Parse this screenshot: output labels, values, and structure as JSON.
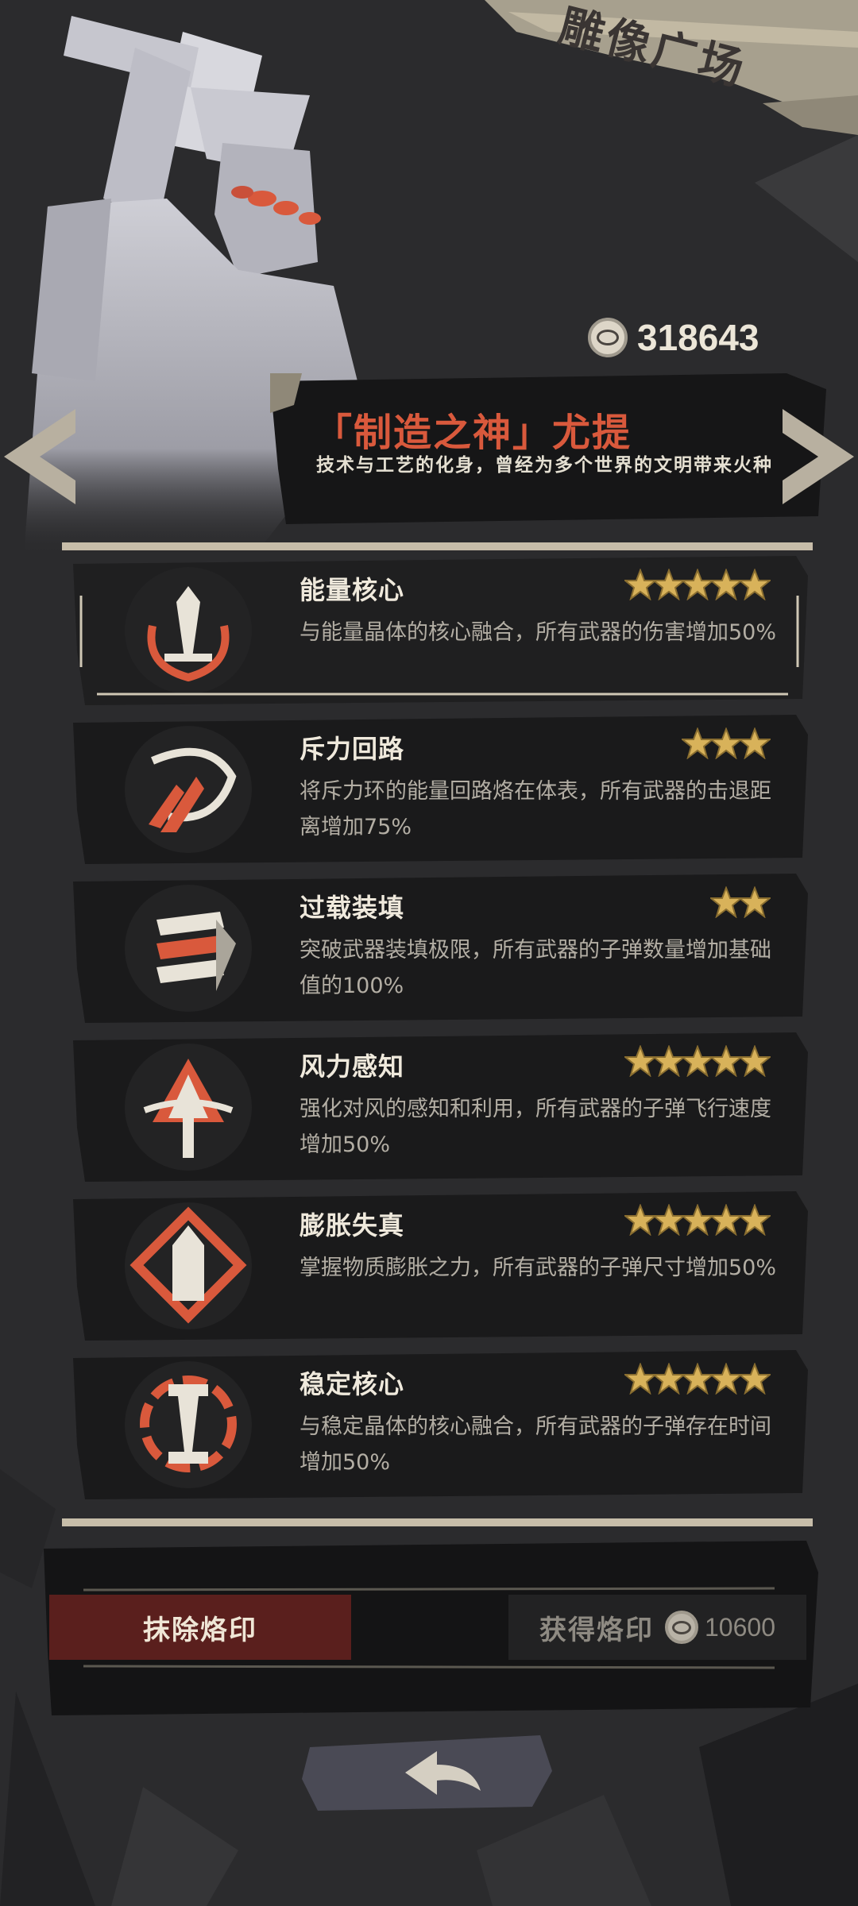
{
  "header": {
    "title": "雕像广场",
    "currency_icon": "eye-coin-icon",
    "currency_amount": "318643"
  },
  "deity": {
    "name": "「制造之神」尤提",
    "description": "技术与工艺的化身，曾经为多个世界的文明带来火种"
  },
  "skills": [
    {
      "name": "能量核心",
      "description": "与能量晶体的核心融合，所有武器的伤害增加50%",
      "stars": 5,
      "icon": "sword-icon",
      "selected": true
    },
    {
      "name": "斥力回路",
      "description": "将斥力环的能量回路烙在体表，所有武器的击退距离增加75%",
      "stars": 3,
      "icon": "repulsion-swirl-icon",
      "selected": false
    },
    {
      "name": "过载装填",
      "description": "突破武器装填极限，所有武器的子弹数量增加基础值的100%",
      "stars": 2,
      "icon": "magazine-overload-icon",
      "selected": false
    },
    {
      "name": "风力感知",
      "description": "强化对风的感知和利用，所有武器的子弹飞行速度增加50%",
      "stars": 5,
      "icon": "wind-arrow-icon",
      "selected": false
    },
    {
      "name": "膨胀失真",
      "description": "掌握物质膨胀之力，所有武器的子弹尺寸增加50%",
      "stars": 5,
      "icon": "expanding-bullet-icon",
      "selected": false
    },
    {
      "name": "稳定核心",
      "description": "与稳定晶体的核心融合，所有武器的子弹存在时间增加50%",
      "stars": 5,
      "icon": "stable-core-icon",
      "selected": false
    }
  ],
  "actions": {
    "remove_label": "抹除烙印",
    "obtain_label": "获得烙印",
    "obtain_cost": "10600",
    "cost_icon": "eye-coin-icon"
  },
  "colors": {
    "accent_red": "#d9593c",
    "star_gold": "#d8b25a",
    "background": "#2b2b2d"
  }
}
